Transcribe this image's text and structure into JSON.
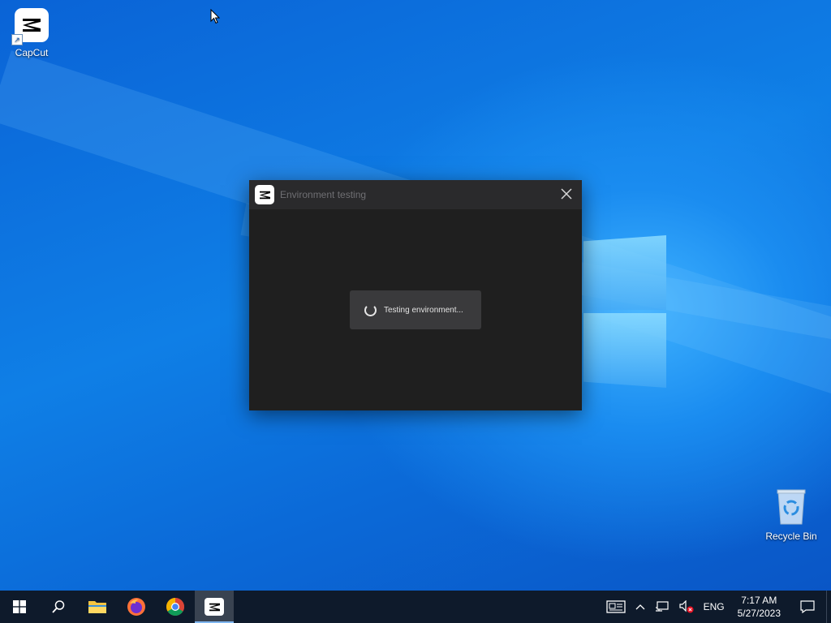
{
  "desktop": {
    "icons": [
      {
        "label": "CapCut",
        "icon": "capcut-icon"
      },
      {
        "label": "Recycle Bin",
        "icon": "recycle-bin-icon"
      }
    ]
  },
  "dialog": {
    "title": "Environment testing",
    "close_icon": "close-icon",
    "status_message": "Testing environment..."
  },
  "taskbar": {
    "items": [
      {
        "name": "start",
        "icon": "windows-start-icon"
      },
      {
        "name": "search",
        "icon": "search-icon"
      },
      {
        "name": "file-explorer",
        "icon": "folder-icon"
      },
      {
        "name": "firefox",
        "icon": "firefox-icon"
      },
      {
        "name": "chrome",
        "icon": "chrome-icon"
      },
      {
        "name": "capcut",
        "icon": "capcut-icon",
        "active": true
      }
    ],
    "tray": {
      "language": "ENG",
      "time": "7:17 AM",
      "date": "5/27/2023"
    }
  },
  "colors": {
    "taskbar_bg": "#0e1a2b",
    "dialog_bg": "#1f1f1f",
    "dialog_titlebar": "#2a2a2c",
    "toast_bg": "#3a3a3c"
  }
}
